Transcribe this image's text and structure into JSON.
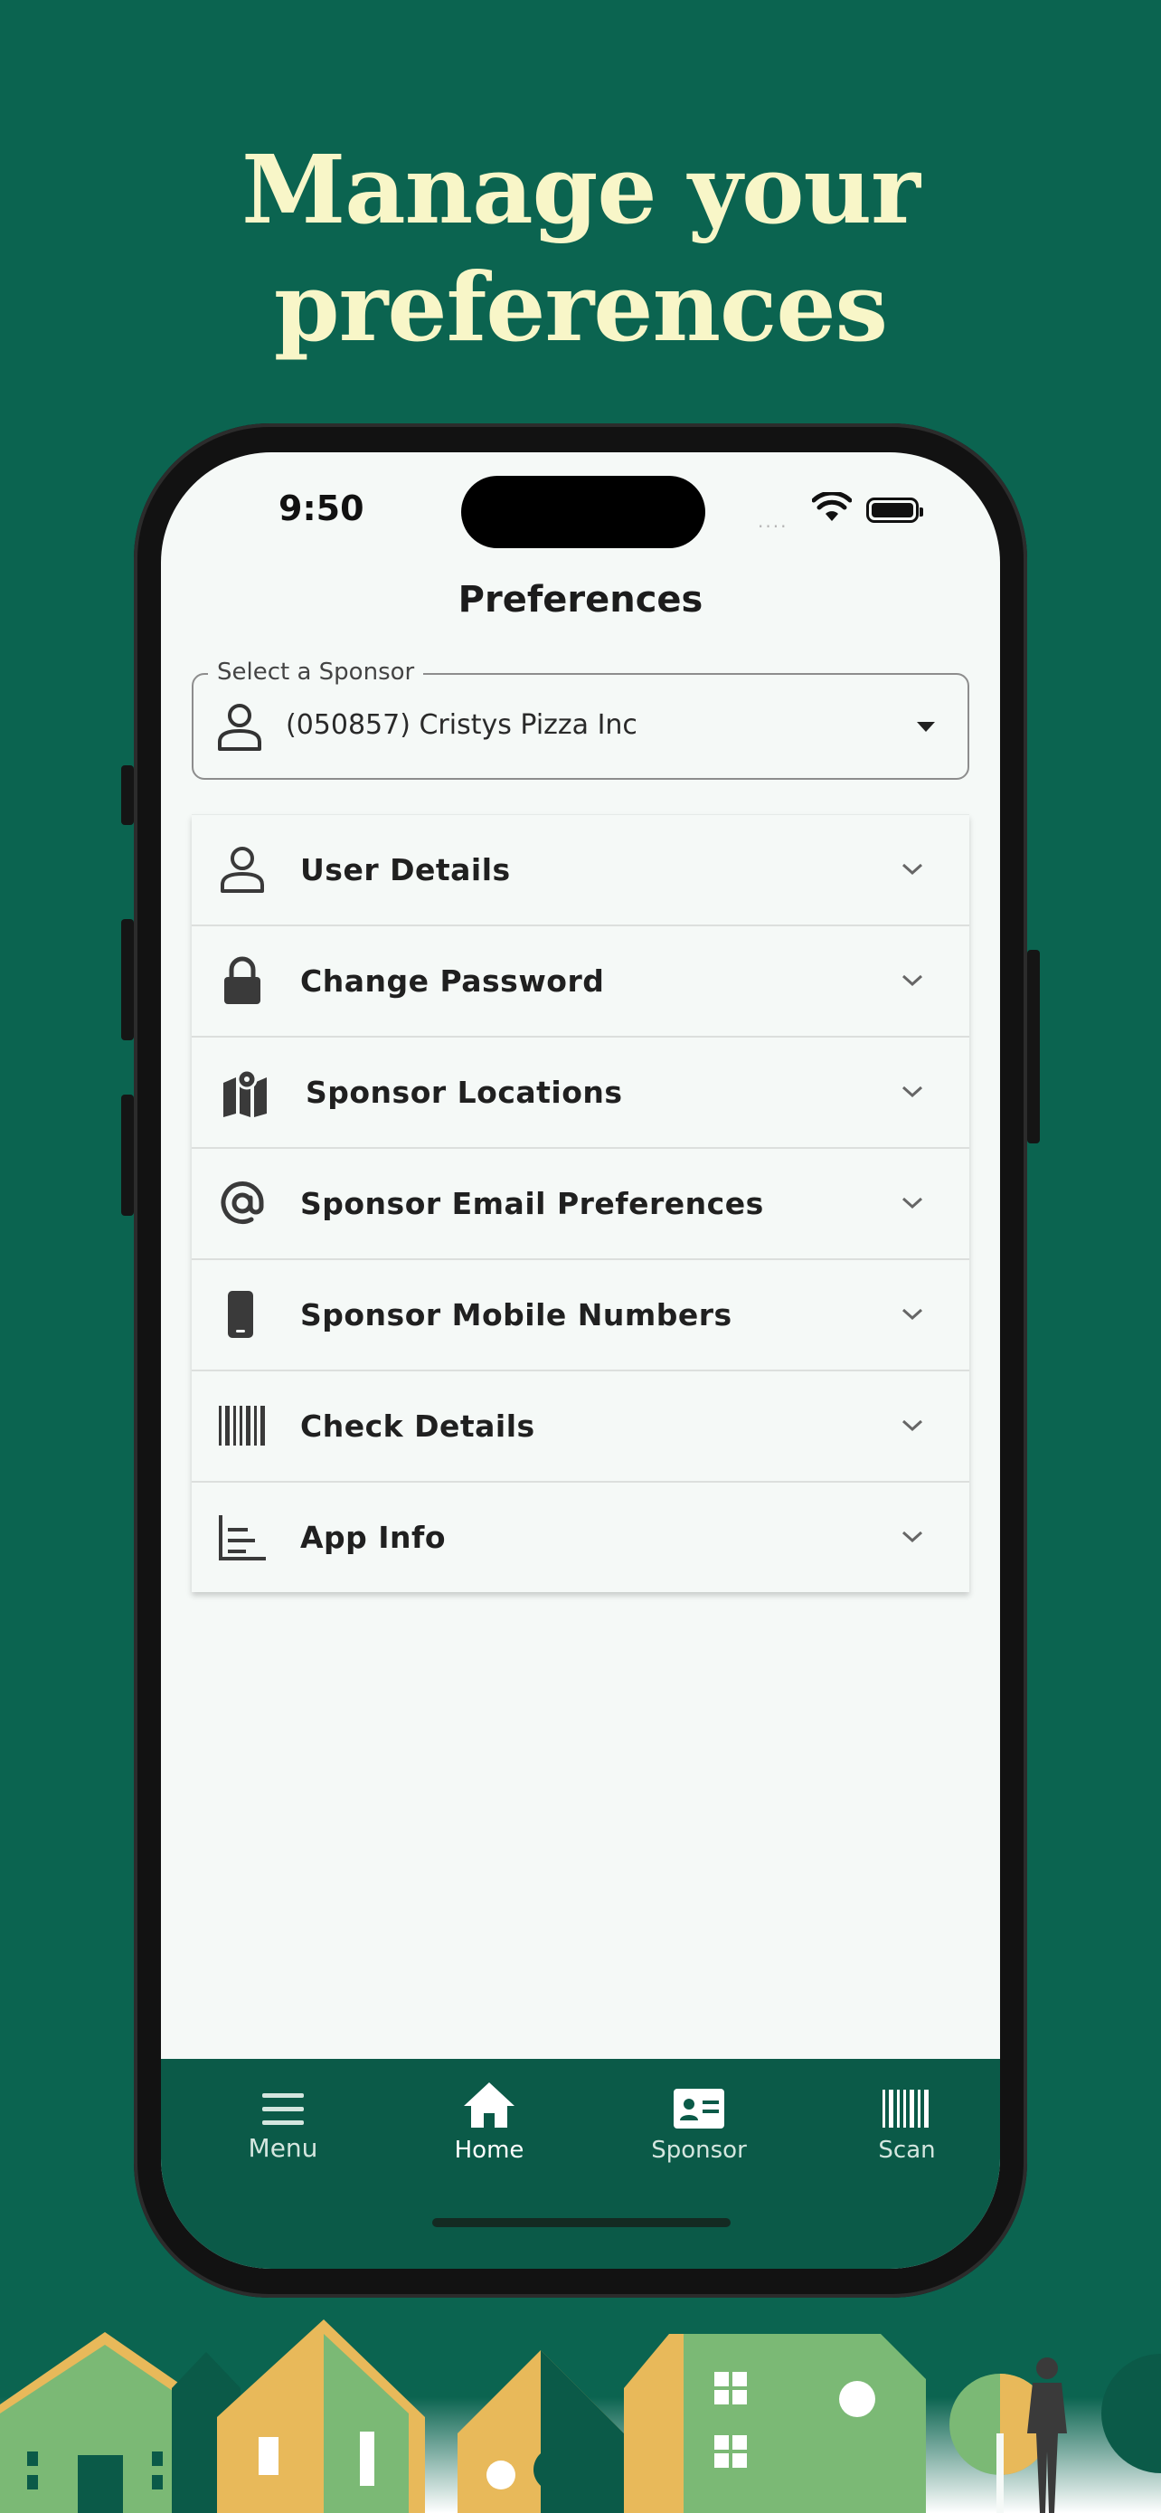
{
  "headline": {
    "line1": "Manage your",
    "line2": "preferences"
  },
  "status_bar": {
    "time": "9:50",
    "signal": "....",
    "icons": [
      "wifi-icon",
      "battery-icon"
    ]
  },
  "page": {
    "title": "Preferences"
  },
  "sponsor_select": {
    "label": "Select a Sponsor",
    "value": "(050857) Cristys Pizza Inc",
    "icon": "person-icon"
  },
  "sections": [
    {
      "label": "User Details",
      "icon": "person-icon"
    },
    {
      "label": "Change Password",
      "icon": "lock-icon"
    },
    {
      "label": "Sponsor Locations",
      "icon": "map-icon"
    },
    {
      "label": "Sponsor Email Preferences",
      "icon": "at-sign-icon"
    },
    {
      "label": "Sponsor Mobile Numbers",
      "icon": "mobile-phone-icon"
    },
    {
      "label": "Check Details",
      "icon": "barcode-icon"
    },
    {
      "label": "App Info",
      "icon": "chart-icon"
    }
  ],
  "tab_bar": {
    "tabs": [
      {
        "label": "Menu",
        "icon": "menu-icon"
      },
      {
        "label": "Home",
        "icon": "home-icon"
      },
      {
        "label": "Sponsor",
        "icon": "id-card-icon"
      },
      {
        "label": "Scan",
        "icon": "barcode-icon"
      }
    ]
  },
  "colors": {
    "background": "#0b6450",
    "headline": "#f8f6c8",
    "tab_bar": "#0b5a48",
    "screen": "#f5f9f7"
  }
}
